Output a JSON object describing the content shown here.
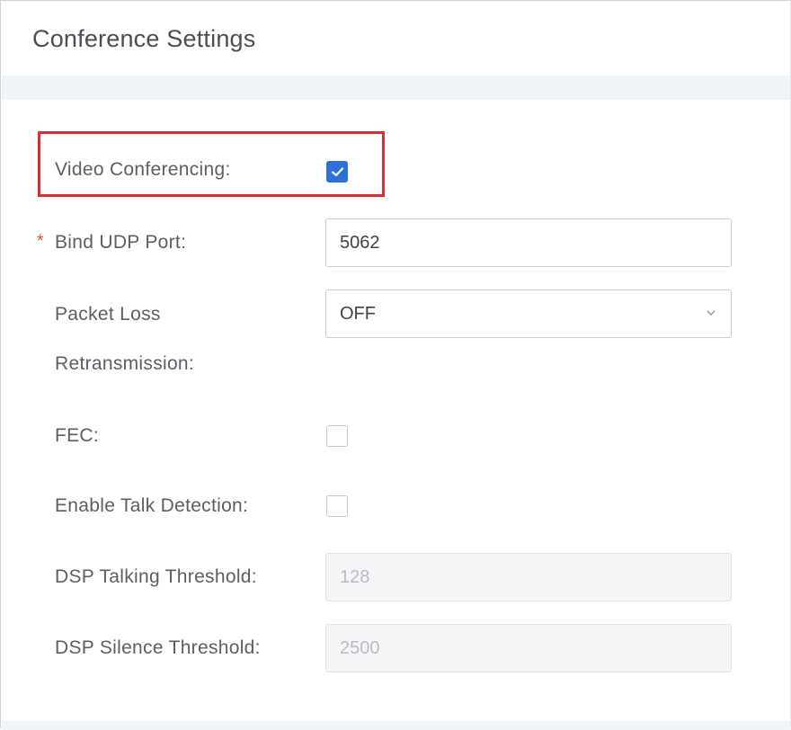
{
  "panel": {
    "title": "Conference Settings"
  },
  "form": {
    "video_conferencing": {
      "label": "Video Conferencing:",
      "checked": true
    },
    "bind_udp_port": {
      "label": "Bind UDP Port:",
      "required_mark": "*",
      "value": "5062"
    },
    "packet_loss": {
      "label_line1": "Packet Loss",
      "label_line2": "Retransmission:",
      "selected": "OFF"
    },
    "fec": {
      "label": "FEC:",
      "checked": false
    },
    "talk_detection": {
      "label": "Enable Talk Detection:",
      "checked": false
    },
    "dsp_talking": {
      "label": "DSP Talking Threshold:",
      "value": "128"
    },
    "dsp_silence": {
      "label": "DSP Silence Threshold:",
      "value": "2500"
    }
  },
  "colors": {
    "accent": "#2f6fdb",
    "highlight_border": "#d9302f",
    "required": "#e8473f"
  },
  "icons": {
    "checkmark": "check-icon",
    "dropdown": "chevron-down-icon"
  }
}
